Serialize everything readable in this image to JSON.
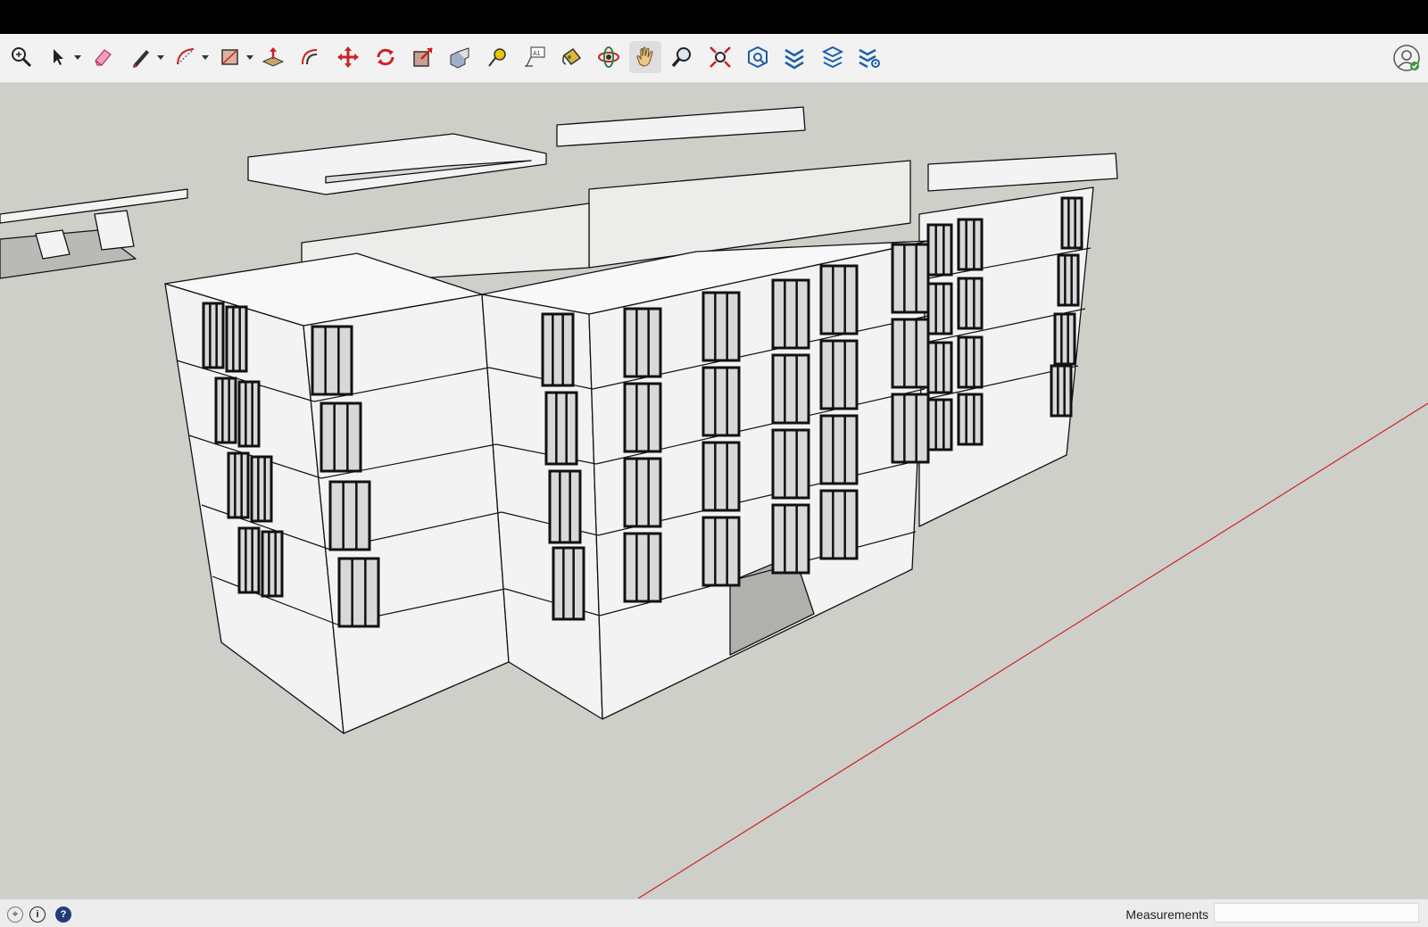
{
  "toolbar": {
    "tools": [
      {
        "name": "zoom-window",
        "icon": "magnifier-plus-icon"
      },
      {
        "name": "select",
        "icon": "arrow-cursor-icon"
      },
      {
        "name": "eraser",
        "icon": "eraser-icon"
      },
      {
        "name": "line",
        "icon": "pencil-icon"
      },
      {
        "name": "arc",
        "icon": "arc-icon"
      },
      {
        "name": "rectangle",
        "icon": "rectangle-icon"
      },
      {
        "name": "push-pull",
        "icon": "push-pull-icon"
      },
      {
        "name": "offset",
        "icon": "offset-icon"
      },
      {
        "name": "move",
        "icon": "move-arrows-icon"
      },
      {
        "name": "rotate",
        "icon": "rotate-icon"
      },
      {
        "name": "scale",
        "icon": "scale-icon"
      },
      {
        "name": "follow-me",
        "icon": "follow-me-icon"
      },
      {
        "name": "tape-measure",
        "icon": "tape-measure-icon"
      },
      {
        "name": "text",
        "icon": "text-icon"
      },
      {
        "name": "paint-bucket",
        "icon": "paint-bucket-icon"
      },
      {
        "name": "orbit",
        "icon": "orbit-icon"
      },
      {
        "name": "pan",
        "icon": "hand-icon"
      },
      {
        "name": "zoom",
        "icon": "magnifier-icon"
      },
      {
        "name": "zoom-extents",
        "icon": "zoom-extents-icon"
      },
      {
        "name": "warehouse",
        "icon": "warehouse-icon"
      },
      {
        "name": "extension-warehouse",
        "icon": "extension-icon"
      },
      {
        "name": "layout",
        "icon": "layout-icon"
      },
      {
        "name": "extension-manager",
        "icon": "extension-manager-icon"
      }
    ],
    "active_tool": "pan",
    "account_icon": "account-icon"
  },
  "status": {
    "icons": [
      "geo-location-icon",
      "credits-icon",
      "help-icon"
    ],
    "measurements_label": "Measurements",
    "measurements_value": ""
  },
  "colors": {
    "viewport_bg": "#cfcfca",
    "axis_red": "#cc2222",
    "toolbar_bg": "#f2f2f2"
  }
}
